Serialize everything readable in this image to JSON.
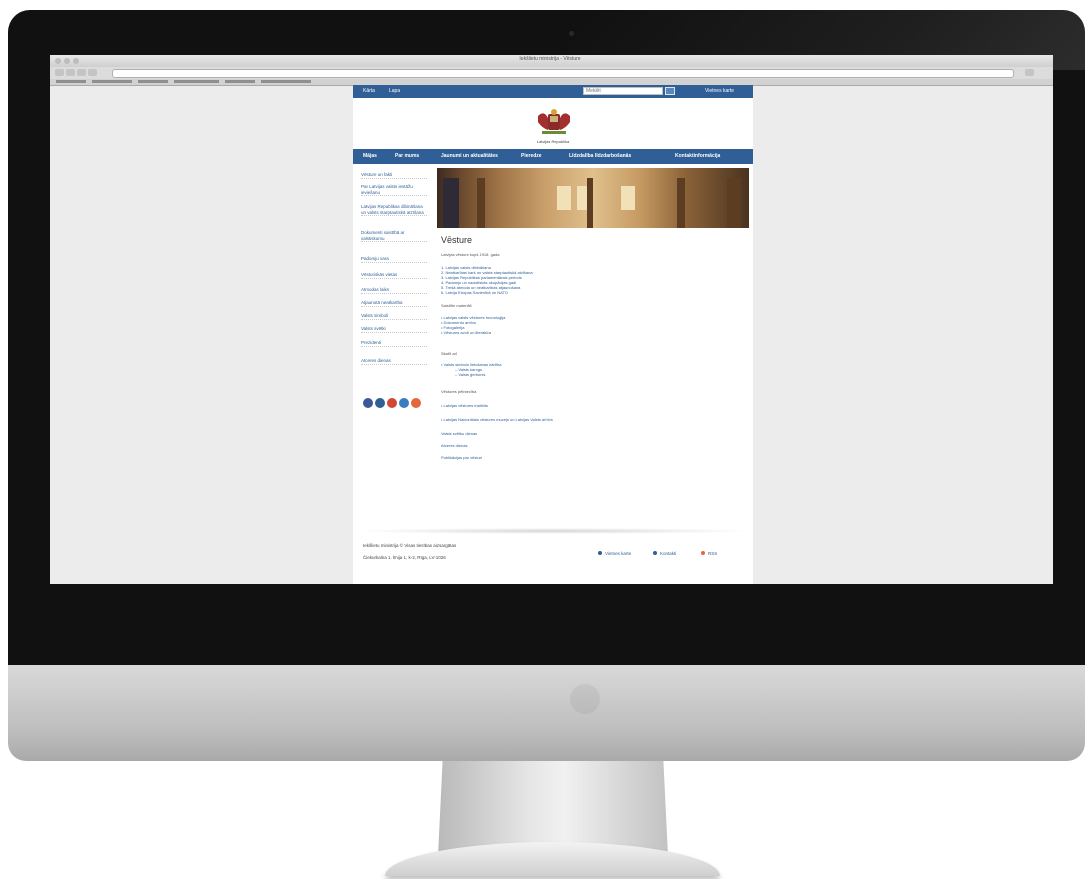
{
  "browser": {
    "window_title": "Iekšlietu ministrija - Vēsture",
    "bookmarks": [
      "",
      "",
      "",
      "",
      "",
      ""
    ]
  },
  "site": {
    "topbar": {
      "links": [
        "Kārta",
        "Lapa"
      ],
      "search_placeholder": "Meklēt",
      "right_link": "Vietnes karte"
    },
    "crest_label": "Latvijas Republika",
    "main_nav": [
      "Mājas",
      "Par mums",
      "Jaunumi un aktualitātes",
      "Pieredze",
      "Līdzdalība līdzdarbošanās",
      "Kontaktinformācija"
    ],
    "sidebar": [
      "Vēsture un fakti",
      "Par Latvijas valsts iestāžu ieviešanu",
      "Latvijas Republikas dibināšana un valsts starptautiskā atzīšana",
      "Dokumenti saistībā ar valstiskumu",
      "Padomju vara",
      "Vēsturiskās vietas",
      "Atmodas laiks",
      "Atjaunotā neatkarība",
      "Valsts simboli",
      "Valsts svētki",
      "Prezidenti",
      "Atceres dienas"
    ],
    "social_colors": [
      "#3b5998",
      "#2f5f96",
      "#d14836",
      "#3b7bbf",
      "#e4683d"
    ],
    "content": {
      "title": "Vēsture",
      "intro": "Latvijas vēsture kopš 1918. gada",
      "list1": [
        "1. Latvijas valsts dibināšana",
        "2. Neatkarības karš un valsts starptautiskā atzīšana",
        "3. Latvijas Republikas parlamentārais periods",
        "4. Padomju un nacistiskās okupācijas gadi",
        "5. Trešā atmoda un neatkarības atjaunošana",
        "6. Latvija Eiropas Savienībā un NATO"
      ],
      "subheading1": "Saistītie materiāli",
      "list2": [
        "• Latvijas valsts vēstures hronoloģija",
        "• Dokumentu arhīvs",
        "• Fotogalerija",
        "• Vēstures avoti un literatūra"
      ],
      "subheading2": "Skatīt arī",
      "list3": [
        "• Valsts simbolu lietošanas kārtība",
        "  – Valsts karogs",
        "  – Valsts ģerbonis"
      ],
      "paragraphs": [
        "Vēstures pētniecība",
        "• Latvijas vēstures institūts",
        "• Latvijas Nacionālais vēstures muzejs un Latvijas Valsts arhīvs",
        "Valsts svētku dienas",
        "Atceres dienas",
        "Publikācijas par vēsturi"
      ]
    },
    "footer": {
      "line1": "Iekšlietu ministrija © Visas tiesības aizsargātas",
      "line2": "Čiekurkalna 1. līnija 1, k-2, Rīga, LV-1026",
      "links": [
        "Vietnes karte",
        "Kontakti",
        "RSS"
      ]
    }
  }
}
